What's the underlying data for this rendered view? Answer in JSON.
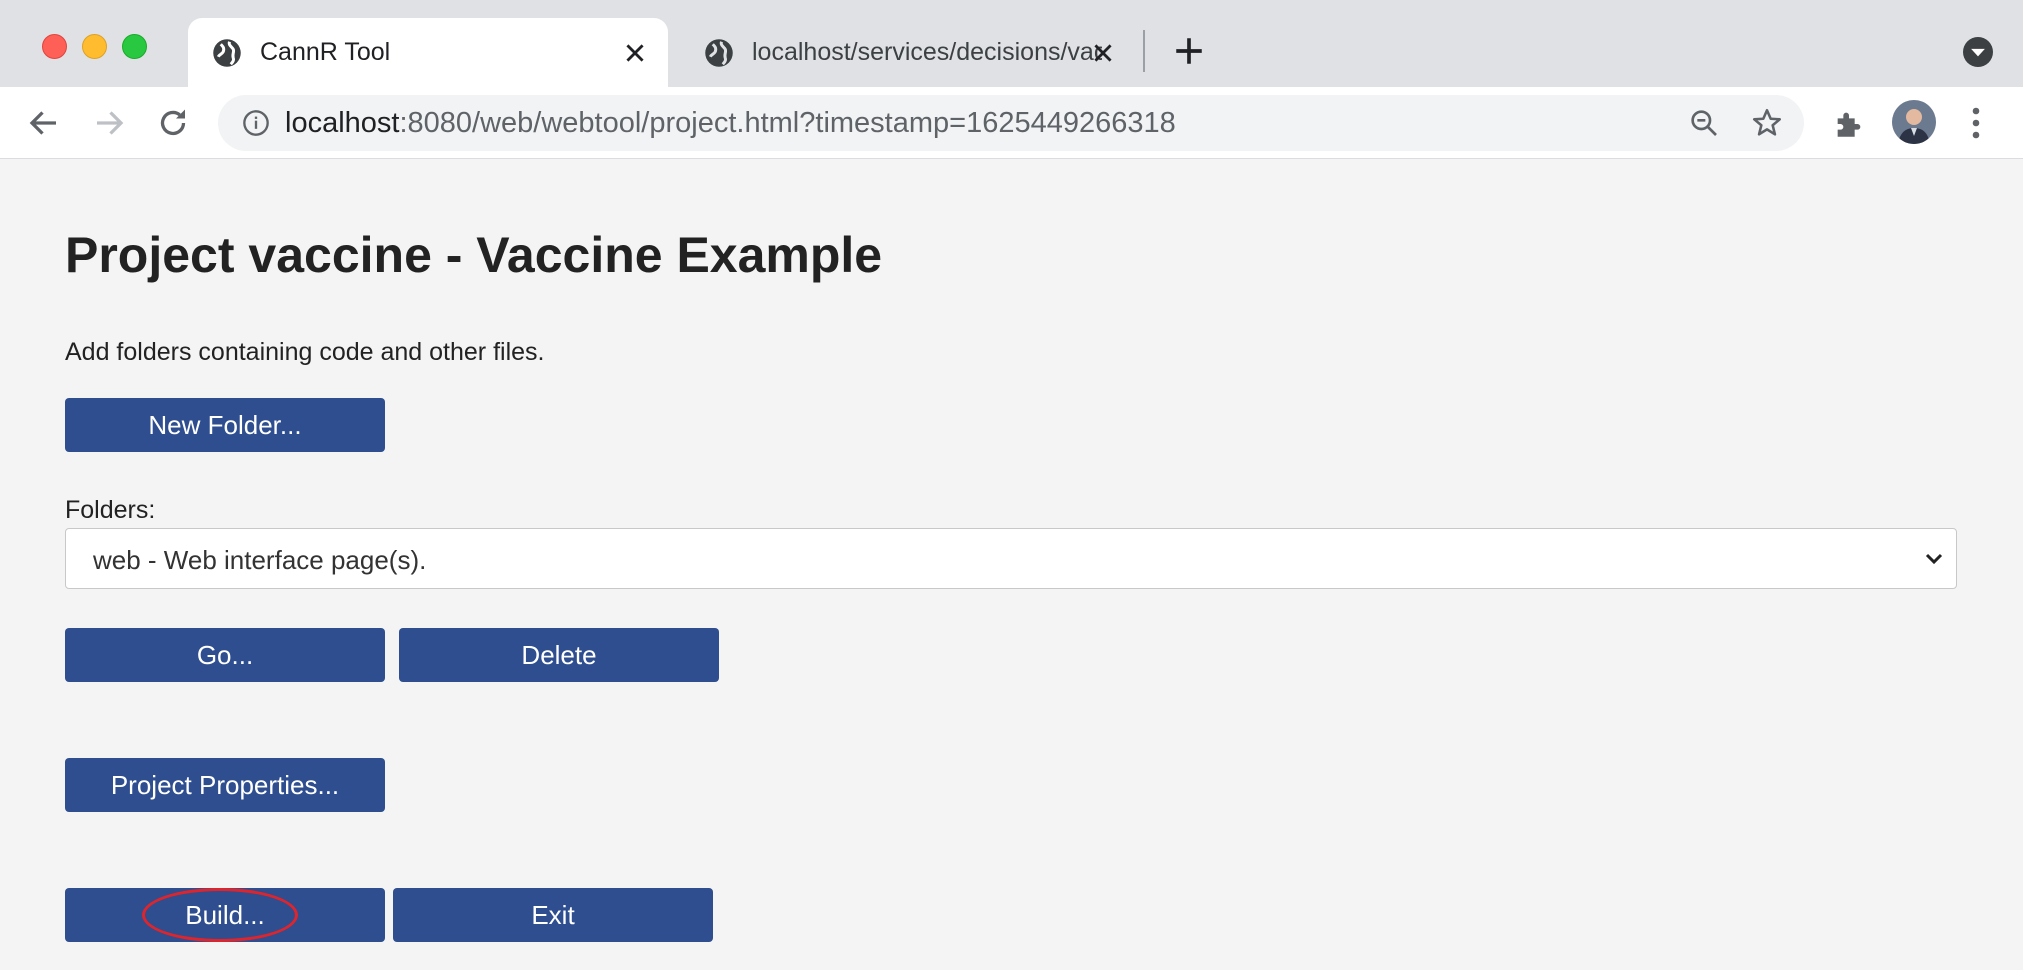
{
  "browser": {
    "tabs": [
      {
        "title": "CannR Tool",
        "active": true,
        "icon": "globe-icon"
      },
      {
        "title": "localhost/services/decisions/vaccine",
        "active": false,
        "icon": "globe-icon"
      }
    ],
    "address": {
      "host": "localhost",
      "rest": ":8080/web/webtool/project.html?timestamp=1625449266318"
    }
  },
  "page": {
    "title": "Project vaccine - Vaccine Example",
    "intro": "Add folders containing code and other files.",
    "new_folder_label": "New Folder...",
    "folders_label": "Folders:",
    "folder_selected": "web - Web interface page(s).",
    "go_label": "Go...",
    "delete_label": "Delete",
    "properties_label": "Project Properties...",
    "build_label": "Build...",
    "exit_label": "Exit"
  },
  "colors": {
    "button_bg": "#2e4e8f",
    "page_bg": "#f4f4f4",
    "highlight": "#e0242b"
  }
}
